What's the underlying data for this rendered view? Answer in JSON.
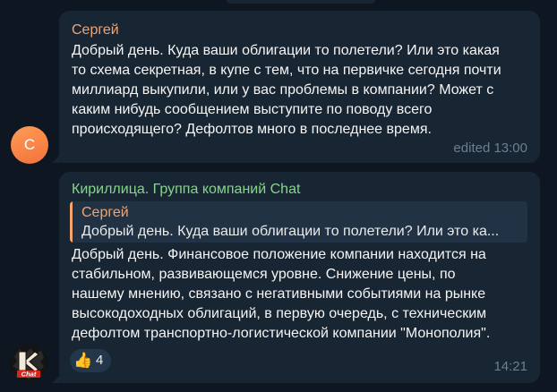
{
  "messages": [
    {
      "author": "Сергей",
      "avatar_letter": "С",
      "author_color": "#f3a470",
      "text": "Добрый день. Куда ваши облигации то полетели? Или это какая\nто схема секретная, в купе с тем, что на первичке сегодня почти\nмиллиард выкупили, или у вас проблемы в компании? Может с\nкаким нибудь сообщением выступите по поводу всего\nпроисходящего? Дефолтов много в последнее время.",
      "meta": "edited 13:00"
    },
    {
      "author": "Кириллица. Группа компаний Chat",
      "author_color": "#85d68b",
      "avatar_logo_text": "Chat",
      "reply_to": {
        "author": "Сергей",
        "text": "Добрый день. Куда ваши облигации то полетели? Или это ка..."
      },
      "text": "Добрый день. Финансовое положение компании находится на\nстабильном, развивающемся уровне. Снижение цены, по\nнашему мнению, связано с негативными событиями на рынке\nвысокодоходных облигаций, в первую очередь, с техническим\nдефолтом транспортно-логистической компании \"Монополия\".",
      "reaction": {
        "emoji": "👍",
        "icon": "thumbs-up-icon",
        "count": "4"
      },
      "time": "14:21"
    }
  ]
}
